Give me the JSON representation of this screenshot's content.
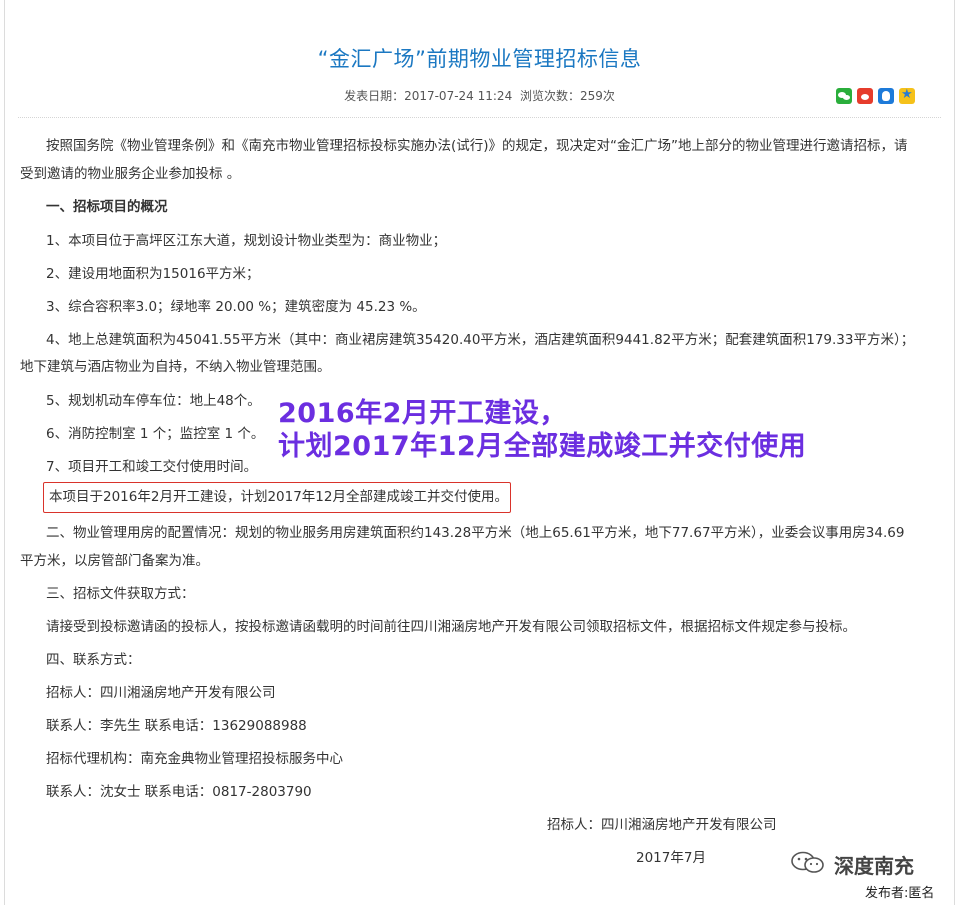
{
  "article": {
    "title": "“金汇广场”前期物业管理招标信息",
    "meta_publish": "发表日期：2017-07-24 11:24",
    "meta_views": "浏览次数：259次"
  },
  "share_icons": [
    "wechat-icon",
    "weibo-icon",
    "qq-icon",
    "qzone-icon"
  ],
  "body": {
    "intro_line1": "按照国务院《物业管理条例》和《南充市物业管理招标投标实施办法(试行)》的规定，现决定对“金汇广场”地上部分的物业管理进行邀请招标，请",
    "intro_line2": "受到邀请的物业服务企业参加投标 。",
    "section1_heading": "一、招标项目的概况",
    "item1": "1、本项目位于高坪区江东大道，规划设计物业类型为：商业物业；",
    "item2": " 2、建设用地面积为15016平方米；",
    "item3": "3、综合容积率3.0；绿地率 20.00  %；建筑密度为 45.23 %。",
    "item4_line1": "4、地上总建筑面积为45041.55平方米（其中：商业裙房建筑35420.40平方米，酒店建筑面积9441.82平方米；配套建筑面积179.33平方米）；",
    "item4_line2": "地下建筑与酒店物业为自持，不纳入物业管理范围。",
    "item5": "5、规划机动车停车位：地上48个。",
    "item6": "6、消防控制室  1 个；监控室 1  个。",
    "item7": "7、项目开工和竣工交付使用时间。",
    "highlight": "本项目于2016年2月开工建设，计划2017年12月全部建成竣工并交付使用。",
    "section2_line1": "二、物业管理用房的配置情况：规划的物业服务用房建筑面积约143.28平方米（地上65.61平方米，地下77.67平方米），业委会议事用房34.69",
    "section2_line2": "平方米，以房管部门备案为准。",
    "section3_heading": "三、招标文件获取方式：",
    "section3_text": "请接受到投标邀请函的投标人，按投标邀请函载明的时间前往四川湘涵房地产开发有限公司领取招标文件，根据招标文件规定参与投标。",
    "section4_heading": "四、联系方式：",
    "tenderer": "招标人：四川湘涵房地产开发有限公司",
    "contact1": "联系人：李先生      联系电话：13629088988",
    "agency": "招标代理机构：南充金典物业管理招投标服务中心",
    "contact2": "联系人：沈女士      联系电话：0817-2803790",
    "sign_tenderer": "招标人：四川湘涵房地产开发有限公司",
    "sign_date": "2017年7月"
  },
  "overlay": {
    "line1": "2016年2月开工建设，",
    "line2": "计划2017年12月全部建成竣工并交付使用",
    "color": "#6b2ee0"
  },
  "watermark": {
    "brand": "深度南充",
    "publisher": "发布者:匿名"
  }
}
